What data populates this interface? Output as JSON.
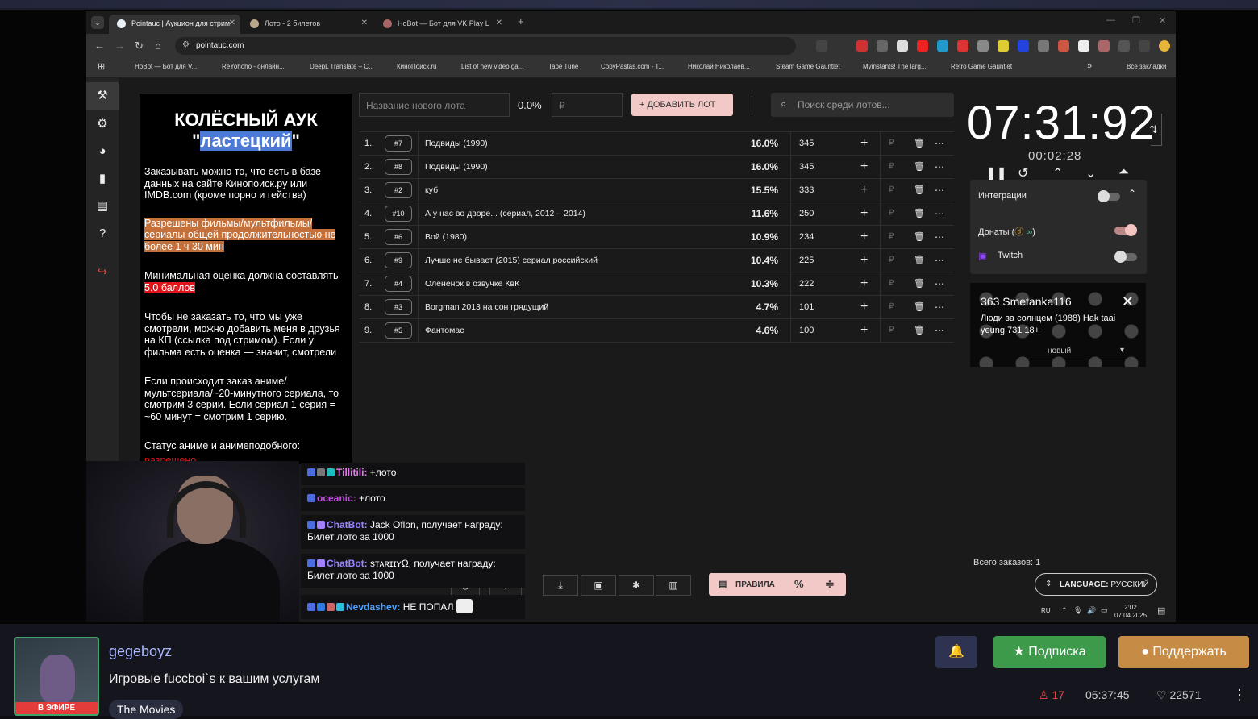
{
  "browser": {
    "tabs": [
      {
        "label": "Pointauc | Аукцион для стрим"
      },
      {
        "label": "Лото - 2 билетов"
      },
      {
        "label": "HoBot — Бот для VK Play L"
      }
    ],
    "url": "pointauc.com",
    "bookmarks": [
      "HoBot — Бот для V...",
      "ReYohoho - онлайн...",
      "DeepL Translate – С...",
      "КиноПоиск.ru",
      "List of new video ga...",
      "Tape Tune",
      "CopyPastas.com - T...",
      "Николай Николаев...",
      "Steam Game Gauntlet",
      "Myinstants! The larg...",
      "Retro Game Gauntlet"
    ],
    "all_bookmarks": "Все закладки",
    "more_bookmarks": "»"
  },
  "rules": {
    "title_line1": "КОЛЁСНЫЙ АУК",
    "title_q1": "\"",
    "title_highlight": "ластецкий",
    "title_q2": "\"",
    "p1": "Заказывать можно то, что есть в базе данных на сайте Кинопоиск.ру или IMDB.com (кроме порно и гейства)",
    "p2": "Разрешены фильмы/мультфильмы/ сериалы общей продолжительностью не более 1 ч 30 мин",
    "p3a": "Минимальная оценка должна составлять ",
    "p3b": "5.0 баллов",
    "p4": "Чтобы не заказать то, что мы уже смотрели, можно добавить меня в друзья на КП (ссылка под стримом). Если у фильма есть оценка — значит, смотрели",
    "p5": "Если происходит заказ аниме/ мультсериала/~20-минутного сериала, то смотрим 3 серии. Если сериал 1 серия = ~60 минут = смотрим 1 серию.",
    "p6": "Статус аниме и анимеподобного:",
    "p7": "разрешено"
  },
  "form": {
    "name_placeholder": "Название нового лота",
    "percent": "0.0%",
    "amount_placeholder": "₽",
    "add_label": "+ ДОБАВИТЬ ЛОТ",
    "search_placeholder": "Поиск среди лотов..."
  },
  "lots": [
    {
      "n": "1.",
      "id": "#7",
      "name": "Подвиды (1990)",
      "pct": "16.0%",
      "amount": "345"
    },
    {
      "n": "2.",
      "id": "#8",
      "name": "Подвиды (1990)",
      "pct": "16.0%",
      "amount": "345"
    },
    {
      "n": "3.",
      "id": "#2",
      "name": "куб",
      "pct": "15.5%",
      "amount": "333"
    },
    {
      "n": "4.",
      "id": "#10",
      "name": "А у нас во дворе... (сериал, 2012 – 2014)",
      "pct": "11.6%",
      "amount": "250"
    },
    {
      "n": "5.",
      "id": "#6",
      "name": "Вой (1980)",
      "pct": "10.9%",
      "amount": "234"
    },
    {
      "n": "6.",
      "id": "#9",
      "name": "Лучше не бывает (2015) сериал российский",
      "pct": "10.4%",
      "amount": "225"
    },
    {
      "n": "7.",
      "id": "#4",
      "name": "Оленёнок в озвучке КвК",
      "pct": "10.3%",
      "amount": "222"
    },
    {
      "n": "8.",
      "id": "#3",
      "name": "Borgman 2013 на сон грядущий",
      "pct": "4.7%",
      "amount": "101"
    },
    {
      "n": "9.",
      "id": "#5",
      "name": "Фантомас",
      "pct": "4.6%",
      "amount": "100"
    }
  ],
  "row_symbols": {
    "plus": "+",
    "rub": "₽",
    "trash": "🗑",
    "more": "⋯"
  },
  "timer": {
    "main": "07:31:92",
    "sub": "00:02:28"
  },
  "integrations": {
    "title": "Интеграции",
    "donations": "Донаты (",
    "donations_end": ")",
    "twitch": "Twitch"
  },
  "donation": {
    "top": "363 Smetanka116",
    "message": "Люди за солнцем (1988) Hak taai yeung 731 18+",
    "select": "новый"
  },
  "footer": {
    "total": "Всего заказов: 1",
    "language_label": "LANGUAGE:",
    "language_value": "РУССКИЙ",
    "rules_label": "ПРАВИЛА",
    "percent_symbol": "%",
    "dollar": "$"
  },
  "tray": {
    "lang": "RU",
    "time": "2:02",
    "date": "07.04.2025"
  },
  "chat": [
    {
      "nick": "Tillitili:",
      "text": " +лото",
      "color": "#e777f0"
    },
    {
      "nick": "oceanic:",
      "text": " +лото",
      "color": "#c34ce0"
    },
    {
      "nick": "ChatBot:",
      "text": " Jack Oflon, получает награду: Билет лото за 1000",
      "color": "#9a86ff"
    },
    {
      "nick": "ChatBot:",
      "text": " sтᴀʀɪɪʏΩ, получает награду: Билет лото за 1000",
      "color": "#9a86ff"
    },
    {
      "nick": "Nevdashev:",
      "text": " НЕ ПОПАЛ",
      "color": "#4aa0ff"
    }
  ],
  "channel": {
    "name": "gegeboyz",
    "title": "Игровые fuccboi`s к вашим услугам",
    "category": "The Movies",
    "live": "В ЭФИРЕ",
    "subscribe": "Подписка",
    "donate": "Поддержать",
    "viewers": "17",
    "uptime": "05:37:45",
    "likes": "22571"
  }
}
